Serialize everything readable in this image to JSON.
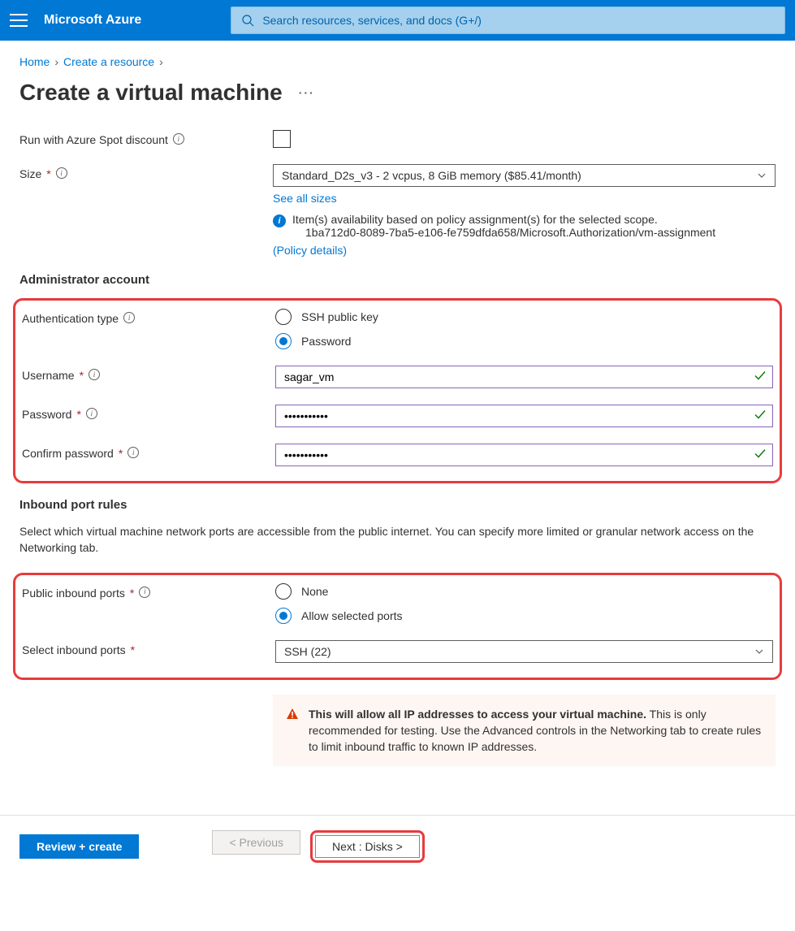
{
  "header": {
    "brand": "Microsoft Azure",
    "search_placeholder": "Search resources, services, and docs (G+/)"
  },
  "breadcrumb": {
    "home": "Home",
    "item1": "Create a resource"
  },
  "page_title": "Create a virtual machine",
  "fields": {
    "spot_discount_label": "Run with Azure Spot discount",
    "size_label": "Size",
    "size_value": "Standard_D2s_v3 - 2 vcpus, 8 GiB memory ($85.41/month)",
    "see_all_sizes": "See all sizes",
    "policy_line1": "Item(s) availability based on policy assignment(s) for the selected scope.",
    "policy_line2": "1ba712d0-8089-7ba5-e106-fe759dfda658/Microsoft.Authorization/vm-assignment",
    "policy_link": "(Policy details)"
  },
  "admin_section": {
    "heading": "Administrator account",
    "auth_type_label": "Authentication type",
    "auth_ssh": "SSH public key",
    "auth_password": "Password",
    "username_label": "Username",
    "username_value": "sagar_vm",
    "password_label": "Password",
    "password_value": "•••••••••••",
    "confirm_label": "Confirm password",
    "confirm_value": "•••••••••••"
  },
  "ports_section": {
    "heading": "Inbound port rules",
    "desc": "Select which virtual machine network ports are accessible from the public internet. You can specify more limited or granular network access on the Networking tab.",
    "public_label": "Public inbound ports",
    "opt_none": "None",
    "opt_allow": "Allow selected ports",
    "select_label": "Select inbound ports",
    "select_value": "SSH (22)",
    "warning_strong": "This will allow all IP addresses to access your virtual machine.",
    "warning_rest": " This is only recommended for testing.  Use the Advanced controls in the Networking tab to create rules to limit inbound traffic to known IP addresses."
  },
  "footer": {
    "review": "Review + create",
    "prev": "< Previous",
    "next": "Next : Disks >"
  }
}
